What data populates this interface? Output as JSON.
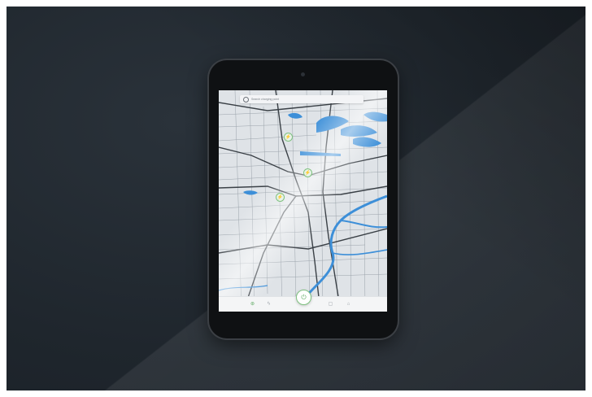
{
  "scene": {
    "background_color": "#1f262d",
    "device": "tablet",
    "device_color": "#0f1113"
  },
  "map_app": {
    "search": {
      "placeholder": "Search charging point",
      "icon": "search-icon"
    },
    "map_colors": {
      "land": "#dfe3e7",
      "water": "#3d8fd8",
      "roads": "#3a4046",
      "accent": "#7ec17f"
    },
    "pins": [
      {
        "name": "charging-pin-1",
        "glyph": "⚡"
      },
      {
        "name": "charging-pin-2",
        "glyph": "⚡"
      },
      {
        "name": "charging-pin-3",
        "glyph": "⚡"
      }
    ],
    "bottom_nav": {
      "items": [
        {
          "name": "nav-item-map",
          "glyph": "⊛",
          "active": true
        },
        {
          "name": "nav-item-stations",
          "glyph": "ϟ",
          "active": false
        },
        {
          "name": "nav-item-center",
          "glyph": "⏻",
          "active": true
        },
        {
          "name": "nav-item-messages",
          "glyph": "▢",
          "active": false
        },
        {
          "name": "nav-item-profile",
          "glyph": "⌂",
          "active": false
        }
      ]
    }
  }
}
